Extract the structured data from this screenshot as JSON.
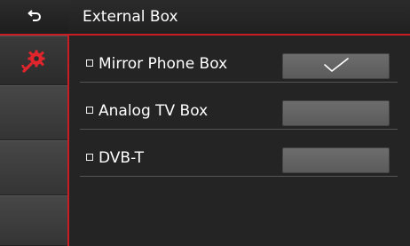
{
  "header": {
    "back_icon": "back-arrow-icon",
    "title": "External Box"
  },
  "sidebar": {
    "active_icon": "settings-gears-icon",
    "accent_color": "#c91d23"
  },
  "options": [
    {
      "label": "Mirror Phone Box",
      "checked": true
    },
    {
      "label": "Analog TV Box",
      "checked": false
    },
    {
      "label": "DVB-T",
      "checked": false
    }
  ]
}
